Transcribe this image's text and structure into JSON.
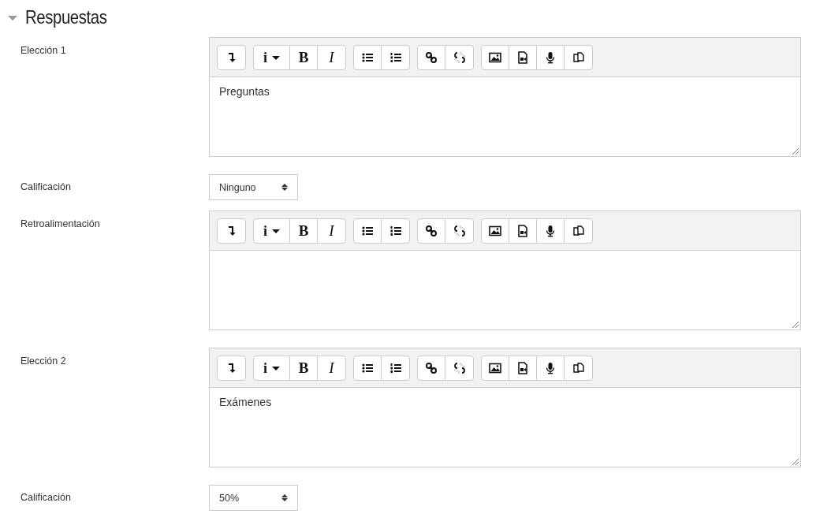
{
  "section": {
    "title": "Respuestas",
    "expanded": true
  },
  "fields": [
    {
      "kind": "editor",
      "label": "Elección 1",
      "value": "Preguntas",
      "toolbar": [
        [
          {
            "kind": "collapse"
          }
        ],
        [
          {
            "kind": "menu",
            "text": "i"
          },
          {
            "kind": "bold",
            "text": "B"
          },
          {
            "kind": "italic",
            "text": "I"
          }
        ],
        [
          {
            "kind": "bullets"
          },
          {
            "kind": "numbered"
          }
        ],
        [
          {
            "kind": "link"
          },
          {
            "kind": "unlink"
          }
        ],
        [
          {
            "kind": "image"
          },
          {
            "kind": "video"
          },
          {
            "kind": "audio"
          },
          {
            "kind": "copy"
          }
        ]
      ]
    },
    {
      "kind": "select",
      "label": "Calificación",
      "value": "Ninguno"
    },
    {
      "kind": "editor",
      "label": "Retroalimentación",
      "toolbar": [
        [
          {
            "kind": "collapse"
          }
        ],
        [
          {
            "kind": "menu",
            "text": "i"
          },
          {
            "kind": "bold",
            "text": "B"
          },
          {
            "kind": "italic",
            "text": "I"
          }
        ],
        [
          {
            "kind": "bullets"
          },
          {
            "kind": "numbered"
          }
        ],
        [
          {
            "kind": "link"
          },
          {
            "kind": "unlink"
          }
        ],
        [
          {
            "kind": "image"
          },
          {
            "kind": "video"
          },
          {
            "kind": "audio"
          },
          {
            "kind": "copy"
          }
        ]
      ]
    },
    {
      "kind": "editor",
      "label": "Elección 2",
      "value": "Exámenes",
      "toolbar": [
        [
          {
            "kind": "collapse"
          }
        ],
        [
          {
            "kind": "menu",
            "text": "i"
          },
          {
            "kind": "bold",
            "text": "B"
          },
          {
            "kind": "italic",
            "text": "I"
          }
        ],
        [
          {
            "kind": "bullets"
          },
          {
            "kind": "numbered"
          }
        ],
        [
          {
            "kind": "link"
          },
          {
            "kind": "unlink"
          }
        ],
        [
          {
            "kind": "image"
          },
          {
            "kind": "video"
          },
          {
            "kind": "audio"
          },
          {
            "kind": "copy"
          }
        ]
      ]
    },
    {
      "kind": "select",
      "label": "Calificación",
      "value": "50%"
    }
  ]
}
